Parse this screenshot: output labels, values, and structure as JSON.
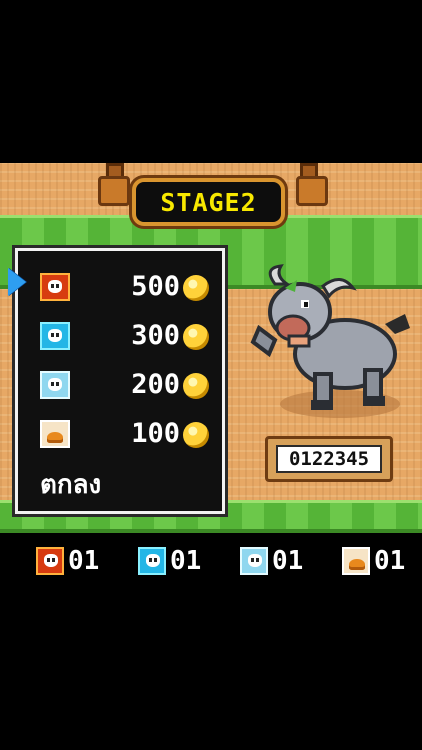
{
  "stage": {
    "title": "STAGE2"
  },
  "shop": {
    "items": [
      {
        "icon": "fire-skull-icon",
        "price": "500",
        "selected": true
      },
      {
        "icon": "ice-skull-icon",
        "price": "300",
        "selected": false
      },
      {
        "icon": "wind-skull-icon",
        "price": "200",
        "selected": false
      },
      {
        "icon": "grain-pile-icon",
        "price": "100",
        "selected": false
      }
    ],
    "confirm_label": "ตกลง"
  },
  "score": {
    "value": "0122345"
  },
  "inventory": [
    {
      "icon": "fire-skull-icon",
      "count": "01"
    },
    {
      "icon": "ice-skull-icon",
      "count": "01"
    },
    {
      "icon": "wind-skull-icon",
      "count": "01"
    },
    {
      "icon": "grain-pile-icon",
      "count": "01"
    }
  ],
  "colors": {
    "sign_text": "#f8e800",
    "cursor": "#2e9ef0",
    "coin": "#ffd23a",
    "grass": "#55b437",
    "sand": "#e7a865"
  }
}
